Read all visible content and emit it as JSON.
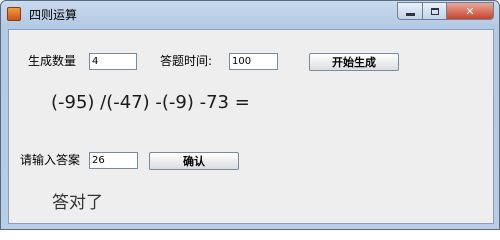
{
  "window": {
    "title": "四则运算",
    "controls": {
      "minimize": "minimize-icon",
      "maximize": "maximize-icon",
      "close": "close-icon"
    }
  },
  "form": {
    "count_label": "生成数量",
    "count_value": "4",
    "time_label": "答题时间:",
    "time_value": "100",
    "generate_label": "开始生成"
  },
  "question": {
    "expression": "(-95) /(-47) -(-9) -73  ="
  },
  "answer": {
    "label": "请输入答案",
    "value": "26",
    "confirm_label": "确认"
  },
  "result": {
    "text": "答对了"
  }
}
